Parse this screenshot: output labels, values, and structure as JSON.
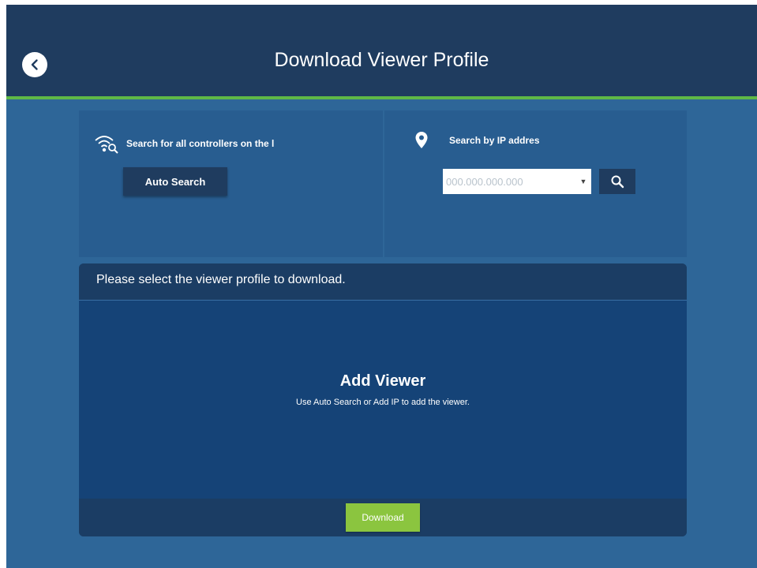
{
  "header": {
    "title": "Download Viewer Profile",
    "back_icon": "chevron-left-icon"
  },
  "auto_search_panel": {
    "icon": "wifi-search-icon",
    "label": "Search for all controllers on the l",
    "button_label": "Auto Search"
  },
  "ip_search_panel": {
    "icon": "location-pin-icon",
    "label": "Search by IP addres",
    "input_placeholder": "000.000.000.000",
    "input_value": "",
    "search_icon": "search-icon"
  },
  "viewer_list": {
    "header_text": "Please select the viewer profile to download.",
    "empty_title": "Add Viewer",
    "empty_message": "Use Auto Search or Add IP to add the viewer.",
    "download_label": "Download"
  },
  "colors": {
    "header_bg": "#1f3c5f",
    "accent_green": "#5fb846",
    "download_green": "#8bc53f",
    "page_bg": "#2e6698"
  }
}
